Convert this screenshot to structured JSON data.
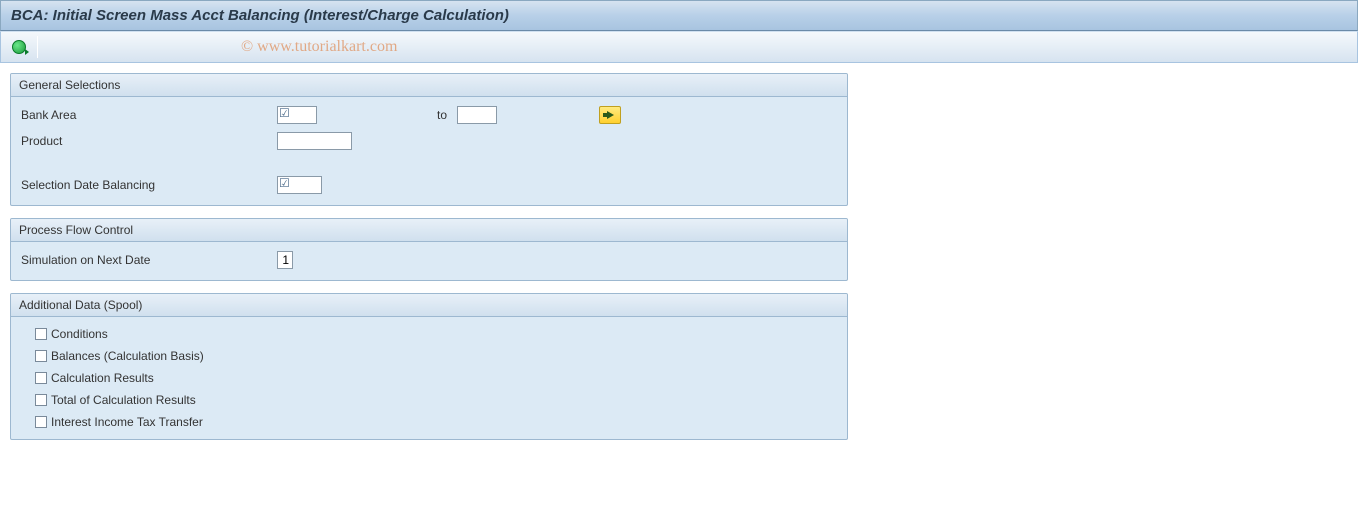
{
  "title": "BCA: Initial Screen Mass Acct Balancing (Interest/Charge Calculation)",
  "watermark": "© www.tutorialkart.com",
  "groups": {
    "general": {
      "title": "General Selections",
      "bank_area_label": "Bank Area",
      "bank_area_from": "",
      "to_label": "to",
      "bank_area_to": "",
      "product_label": "Product",
      "product_value": "",
      "sel_date_label": "Selection Date Balancing",
      "sel_date_value": ""
    },
    "process": {
      "title": "Process Flow Control",
      "sim_next_label": "Simulation on Next Date",
      "sim_next_value": "1"
    },
    "spool": {
      "title": "Additional Data (Spool)",
      "items": [
        "Conditions",
        "Balances (Calculation Basis)",
        "Calculation Results",
        "Total of Calculation Results",
        "Interest Income Tax Transfer"
      ]
    }
  }
}
